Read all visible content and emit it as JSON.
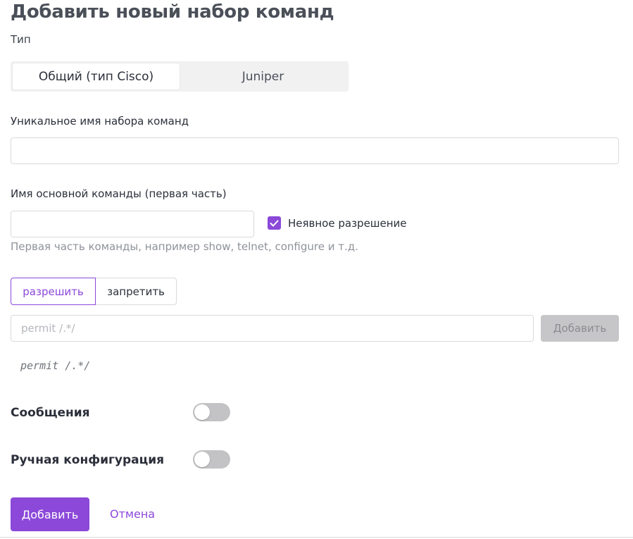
{
  "page": {
    "title": "Добавить новый набор команд",
    "type_label": "Тип"
  },
  "type_selector": {
    "options": [
      {
        "label": "Общий (тип Cisco)",
        "selected": true
      },
      {
        "label": "Juniper",
        "selected": false
      }
    ]
  },
  "unique_name": {
    "label": "Уникальное имя набора команд",
    "value": "",
    "placeholder": ""
  },
  "main_command": {
    "label": "Имя основной команды (первая часть)",
    "value": "",
    "placeholder": "",
    "implicit_permission": {
      "label": "Неявное разрешение",
      "checked": true
    },
    "hint": "Первая часть команды, например show, telnet, configure и т.д."
  },
  "rule_mode": {
    "options": [
      {
        "label": "разрешить",
        "selected": true
      },
      {
        "label": "запретить",
        "selected": false
      }
    ]
  },
  "rule_input": {
    "value": "",
    "placeholder": "permit /.*/",
    "add_label": "Добавить"
  },
  "rule_preview": "permit /.*/",
  "messages": {
    "label": "Сообщения",
    "enabled": false
  },
  "manual_config": {
    "label": "Ручная конфигурация",
    "enabled": false
  },
  "actions": {
    "submit_label": "Добавить",
    "cancel_label": "Отмена"
  },
  "colors": {
    "accent": "#8b48d9",
    "disabled_button": "#c6c6c8",
    "toggle_off": "#c3c3c5"
  }
}
